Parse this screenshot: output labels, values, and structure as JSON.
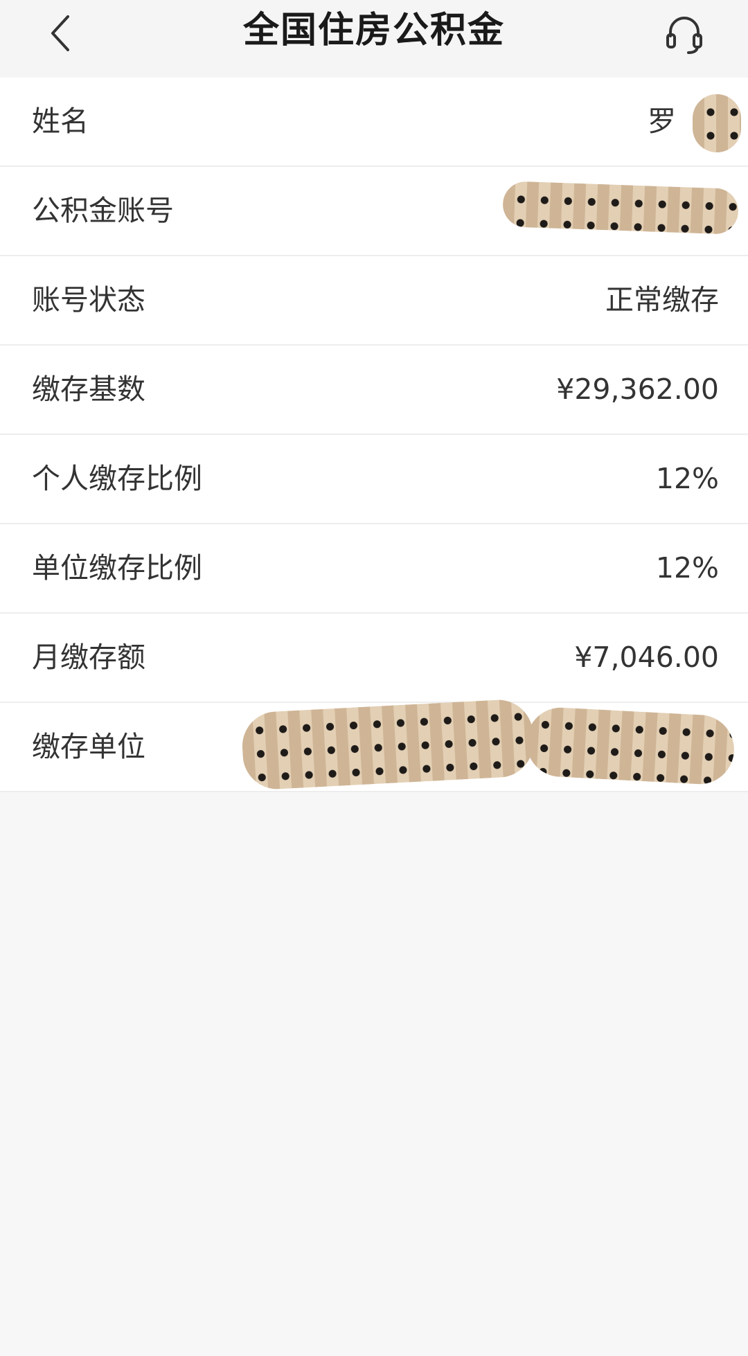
{
  "navbar": {
    "title": "全国住房公积金",
    "back_icon": "chevron-left-icon",
    "service_icon": "headset-icon"
  },
  "rows": [
    {
      "label": "姓名",
      "value": "罗"
    },
    {
      "label": "公积金账号",
      "value": ""
    },
    {
      "label": "账号状态",
      "value": "正常缴存"
    },
    {
      "label": "缴存基数",
      "value": "¥29,362.00"
    },
    {
      "label": "个人缴存比例",
      "value": "12%"
    },
    {
      "label": "单位缴存比例",
      "value": "12%"
    },
    {
      "label": "月缴存额",
      "value": "¥7,046.00"
    },
    {
      "label": "缴存单位",
      "value": ""
    }
  ],
  "colors": {
    "background": "#f7f7f7",
    "card": "#ffffff",
    "divider": "#ededed",
    "text": "#333333"
  }
}
